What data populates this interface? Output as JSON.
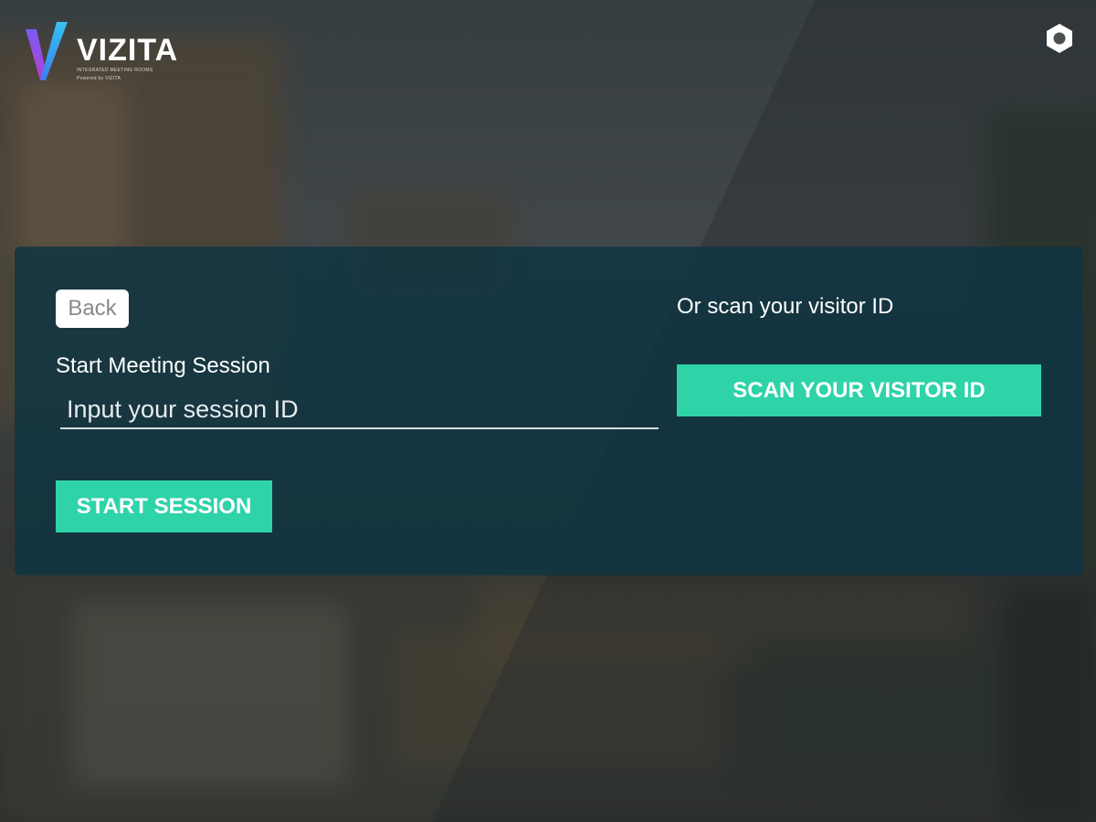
{
  "app": {
    "logo_name": "VIZITA",
    "logo_tagline_1": "INTEGRATED MEETING ROOMS",
    "logo_tagline_2": "Powered by VIZITA"
  },
  "header": {
    "settings_icon": "gear-icon"
  },
  "session": {
    "back_label": "Back",
    "label": "Start Meeting Session",
    "input_value": "",
    "input_placeholder": "Input your session ID",
    "start_label": "START SESSION"
  },
  "scan": {
    "label": "Or scan your visitor ID",
    "button_label": "SCAN YOUR VISITOR ID"
  },
  "colors": {
    "accent": "#2fd3a8",
    "panel": "#0e3442",
    "logo_gradient_top": "#7a5cf0",
    "logo_gradient_bottom": "#2aa8e0"
  }
}
